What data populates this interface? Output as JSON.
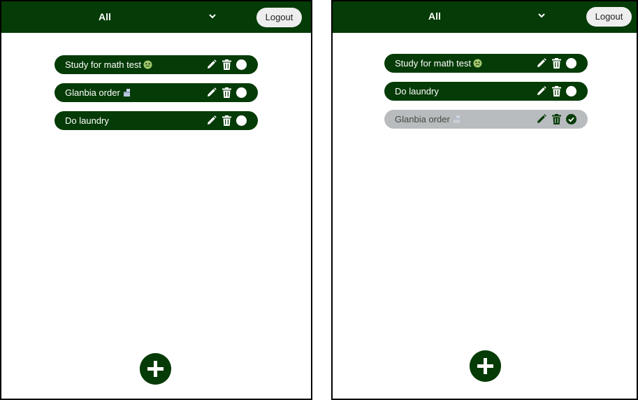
{
  "colors": {
    "primary": "#053b06",
    "done_bg": "#b9bcbf",
    "button_bg": "#eeeeee"
  },
  "panels": [
    {
      "filter": {
        "selected": "All"
      },
      "logout_label": "Logout",
      "todos": [
        {
          "text": "Study for math test",
          "emoji": "nauseated-face-emoji",
          "done": false
        },
        {
          "text": "Glanbia order",
          "emoji": "tub-emoji",
          "done": false
        },
        {
          "text": "Do laundry",
          "emoji": "",
          "done": false
        }
      ],
      "add_icon": "plus-icon"
    },
    {
      "filter": {
        "selected": "All"
      },
      "logout_label": "Logout",
      "todos": [
        {
          "text": "Study for math test",
          "emoji": "nauseated-face-emoji",
          "done": false
        },
        {
          "text": "Do laundry",
          "emoji": "",
          "done": false
        },
        {
          "text": "Glanbia order",
          "emoji": "tub-emoji",
          "done": true
        }
      ],
      "add_icon": "plus-icon"
    }
  ]
}
